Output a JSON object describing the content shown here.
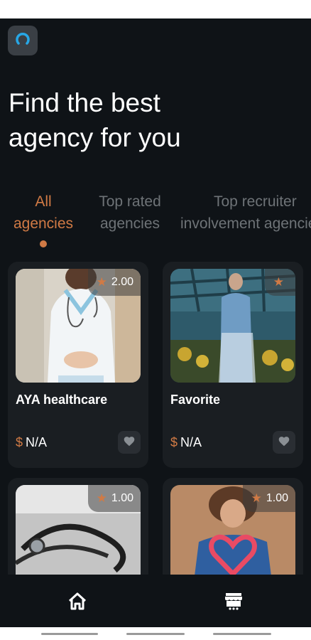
{
  "header": {
    "logo_icon": "app-logo-icon",
    "title_line1": "Find the best",
    "title_line2": "agency for you"
  },
  "tabs": [
    {
      "line1": "All",
      "line2": "agencies",
      "active": true
    },
    {
      "line1": "Top rated",
      "line2": "agencies",
      "active": false
    },
    {
      "line1": "Top recruiter",
      "line2": "involvement agencies",
      "active": false
    }
  ],
  "cards": [
    {
      "name": "AYA healthcare",
      "rating": "2.00",
      "price": "N/A"
    },
    {
      "name": "Favorite",
      "rating": "",
      "price": "N/A"
    },
    {
      "name": "",
      "rating": "1.00",
      "price": ""
    },
    {
      "name": "",
      "rating": "1.00",
      "price": ""
    }
  ],
  "nav": {
    "home_icon": "home-icon",
    "store_icon": "store-icon"
  },
  "colors": {
    "accent": "#d07a45",
    "background": "#0f1317",
    "card": "#1a1e22",
    "inactive_tab": "#6e7377"
  }
}
